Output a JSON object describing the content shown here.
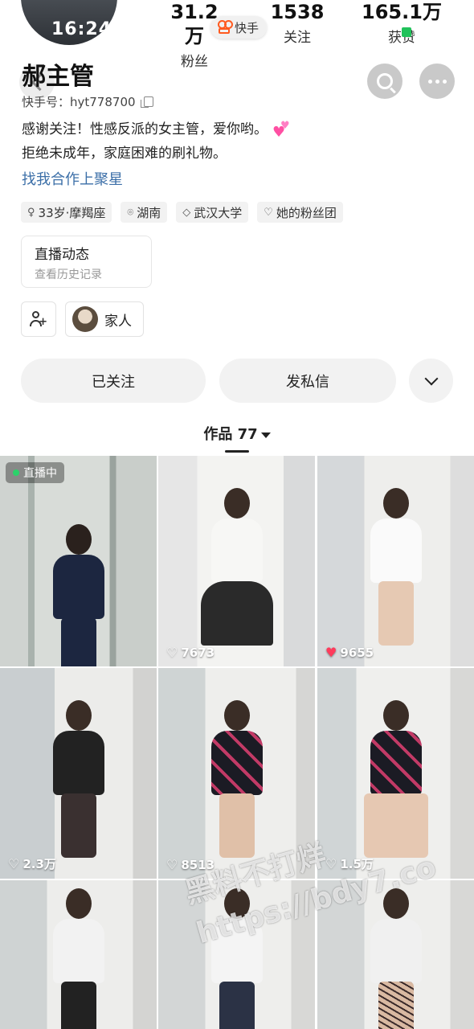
{
  "status_bar": {
    "time": "16:24"
  },
  "stats": {
    "fans": {
      "value": "31.2万",
      "label": "粉丝"
    },
    "following": {
      "value": "1538",
      "label": "关注"
    },
    "likes": {
      "value": "165.1万",
      "label": "获赞"
    }
  },
  "brand": {
    "label": "快手"
  },
  "profile": {
    "name": "郝主管",
    "kuaishou_id": "快手号：hyt778700",
    "bio_line1": "感谢关注！性感反派的女主管，爱你哟。",
    "bio_line2": "拒绝未成年，家庭困难的刷礼物。",
    "link": "找我合作上聚星"
  },
  "tags": [
    {
      "icon": "gender-icon",
      "label": "33岁·摩羯座"
    },
    {
      "icon": "location-icon",
      "label": "湖南"
    },
    {
      "icon": "graduation-icon",
      "label": "武汉大学"
    },
    {
      "icon": "fan-club-icon",
      "label": "她的粉丝团"
    }
  ],
  "live_card": {
    "title": "直播动态",
    "subtitle": "查看历史记录"
  },
  "family": {
    "label": "家人"
  },
  "actions": {
    "followed": "已关注",
    "message": "发私信"
  },
  "works_tab": {
    "label": "作品 77"
  },
  "grid": [
    {
      "badge": "直播中",
      "likes": ""
    },
    {
      "likes": "7673",
      "liked": false
    },
    {
      "likes": "9655",
      "liked": true
    },
    {
      "likes": "2.3万",
      "liked": false
    },
    {
      "likes": "8513",
      "liked": false
    },
    {
      "likes": "1.5万",
      "liked": false
    },
    {
      "likes": "",
      "liked": false
    },
    {
      "likes": "",
      "liked": false
    },
    {
      "likes": "",
      "liked": false
    }
  ],
  "watermark": {
    "line1": "黑料不打烊",
    "line2": "https://bdy7.co"
  },
  "colors": {
    "link": "#3c6fa8",
    "live_dot": "#2bd26a",
    "liked_heart": "#ff3b5c",
    "brand": "#ff5a1f"
  }
}
